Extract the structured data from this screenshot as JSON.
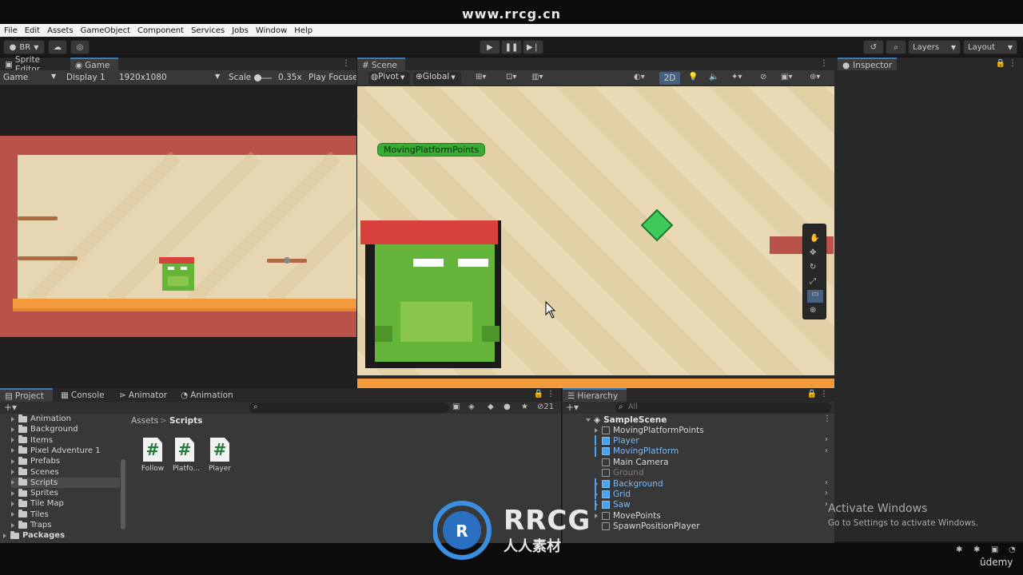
{
  "watermark": {
    "url": "www.rrcg.cn"
  },
  "menu": [
    "File",
    "Edit",
    "Assets",
    "GameObject",
    "Component",
    "Services",
    "Jobs",
    "Window",
    "Help"
  ],
  "toolbar": {
    "account": "BR",
    "layers": "Layers",
    "layout": "Layout"
  },
  "game_panel": {
    "tabs": [
      "Sprite Editor",
      "Game"
    ],
    "mode": "Game",
    "display": "Display 1",
    "resolution": "1920x1080",
    "scale_label": "Scale",
    "scale_value": "0.35x",
    "play_focus": "Play Focused"
  },
  "scene_panel": {
    "tab": "Scene",
    "pivot": "Pivot",
    "global": "Global",
    "mode_2d": "2D",
    "object_label": "MovingPlatformPoints"
  },
  "inspector": {
    "tab": "Inspector"
  },
  "project_panel": {
    "tabs": [
      "Project",
      "Console",
      "Animator",
      "Animation"
    ],
    "breadcrumb": [
      "Assets",
      "Scripts"
    ],
    "hidden_count": "21",
    "tree": [
      {
        "label": "Animation",
        "indent": 1
      },
      {
        "label": "Background",
        "indent": 1
      },
      {
        "label": "Items",
        "indent": 1
      },
      {
        "label": "Pixel Adventure 1",
        "indent": 1
      },
      {
        "label": "Prefabs",
        "indent": 1
      },
      {
        "label": "Scenes",
        "indent": 1
      },
      {
        "label": "Scripts",
        "indent": 1,
        "selected": true
      },
      {
        "label": "Sprites",
        "indent": 1
      },
      {
        "label": "Tile Map",
        "indent": 1
      },
      {
        "label": "Tiles",
        "indent": 1
      },
      {
        "label": "Traps",
        "indent": 1
      },
      {
        "label": "Packages",
        "indent": 0
      }
    ],
    "files": [
      {
        "label": "Follow"
      },
      {
        "label": "Platfo..."
      },
      {
        "label": "Player"
      }
    ]
  },
  "hierarchy": {
    "tab": "Hierarchy",
    "search_placeholder": "All",
    "scene": "SampleScene",
    "items": [
      {
        "label": "MovingPlatformPoints",
        "color": "#d6d6d6",
        "icon": "grey"
      },
      {
        "label": "Player",
        "color": "#7cb8f5",
        "icon": "blue"
      },
      {
        "label": "MovingPlatform",
        "color": "#7cb8f5",
        "icon": "blue"
      },
      {
        "label": "Main Camera",
        "color": "#d6d6d6",
        "icon": "grey"
      },
      {
        "label": "Ground",
        "color": "#7a7a7a",
        "icon": "grey"
      },
      {
        "label": "Background",
        "color": "#7cb8f5",
        "icon": "blue"
      },
      {
        "label": "Grid",
        "color": "#7cb8f5",
        "icon": "blue"
      },
      {
        "label": "Saw",
        "color": "#7cb8f5",
        "icon": "blue"
      },
      {
        "label": "MovePoints",
        "color": "#d6d6d6",
        "icon": "grey"
      },
      {
        "label": "SpawnPositionPlayer",
        "color": "#d6d6d6",
        "icon": "grey"
      }
    ]
  },
  "windows_notice": {
    "title": "Activate Windows",
    "subtitle": "Go to Settings to activate Windows."
  },
  "branding": {
    "logo_text": "RRCG",
    "logo_sub": "人人素材",
    "udemy": "ûdemy"
  }
}
